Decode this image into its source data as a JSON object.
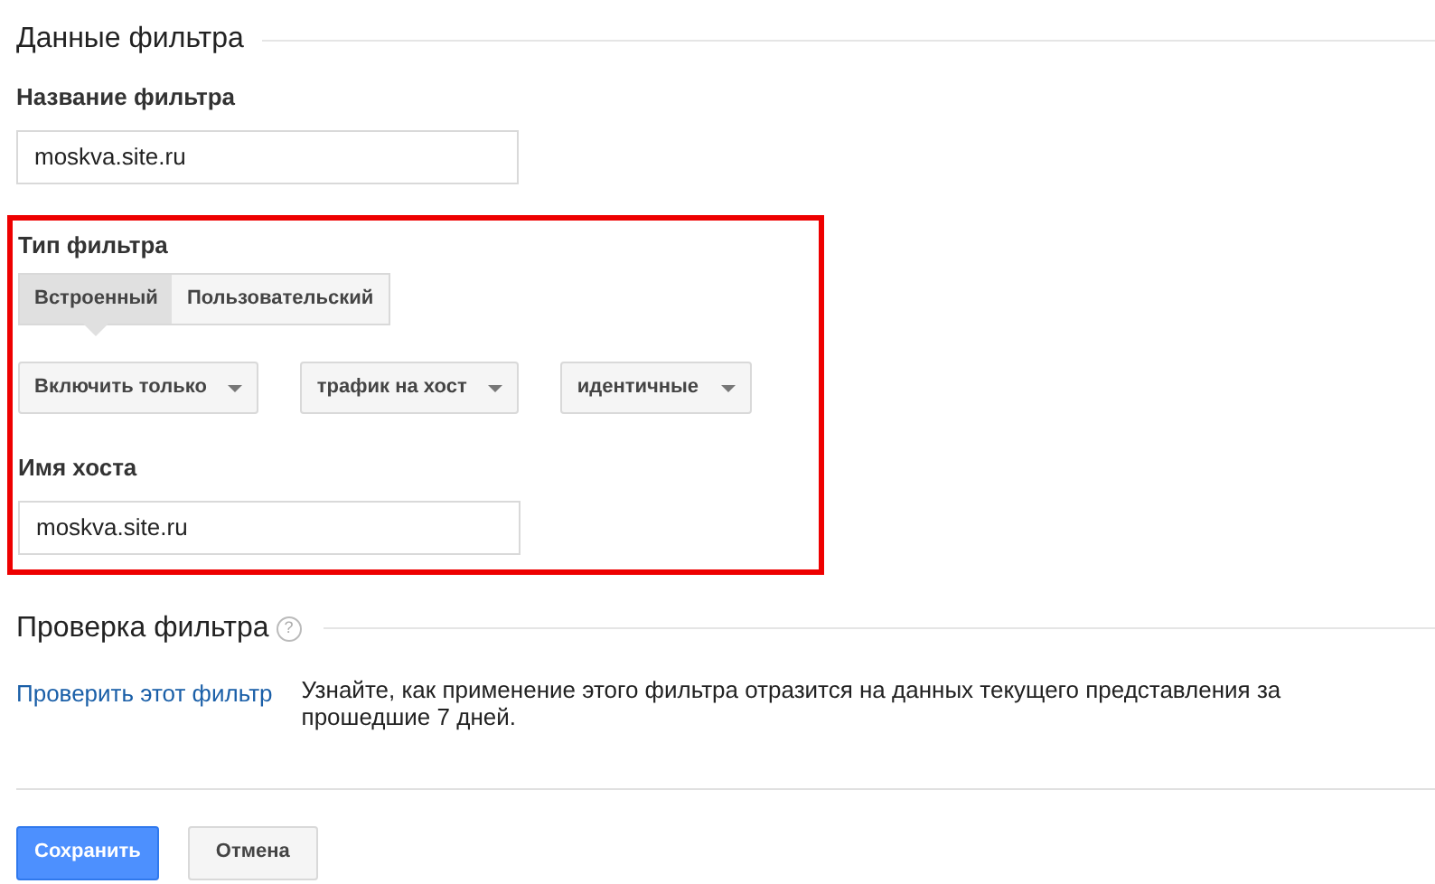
{
  "filter_data": {
    "title": "Данные фильтра",
    "name_field": {
      "label": "Название фильтра",
      "value": "moskva.site.ru"
    },
    "filter_type": {
      "label": "Тип фильтра",
      "tabs": [
        {
          "label": "Встроенный",
          "selected": true
        },
        {
          "label": "Пользовательский",
          "selected": false
        }
      ],
      "dropdowns": [
        {
          "value": "Включить только"
        },
        {
          "value": "трафик на хост"
        },
        {
          "value": "идентичные"
        }
      ],
      "host_field": {
        "label": "Имя хоста",
        "value": "moskva.site.ru"
      }
    }
  },
  "filter_check": {
    "title": "Проверка фильтра",
    "help_icon": "?",
    "link": "Проверить этот фильтр",
    "description": "Узнайте, как применение этого фильтра отразится на данных текущего представления за прошедшие 7 дней."
  },
  "buttons": [
    {
      "label": "Сохранить",
      "kind": "primary"
    },
    {
      "label": "Отмена",
      "kind": "secondary"
    }
  ]
}
